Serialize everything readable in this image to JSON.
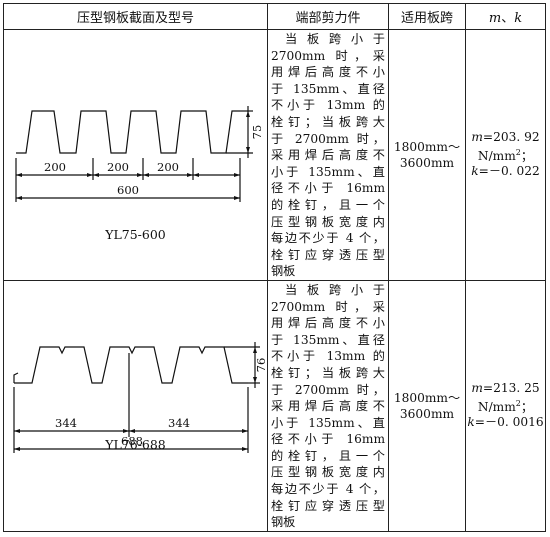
{
  "table": {
    "headers": {
      "section": "压型钢板截面及型号",
      "shear": "端部剪力件",
      "span": "适用板跨",
      "mk_m": "m",
      "mk_sep": "、",
      "mk_k": "k"
    },
    "rows": [
      {
        "model": "YL75-600",
        "dims": {
          "rib1": "200",
          "rib2": "200",
          "rib3": "200",
          "total": "600",
          "height": "75"
        },
        "shear_lines": [
          "当板跨小于",
          "2700mm 时，采",
          "用焊后高度不小",
          "于 135mm、直径",
          "不小于 13mm 的",
          "栓钉；当板跨大",
          "于 2700mm 时，",
          "采用焊后高度不",
          "小于 135mm、直",
          "径不小于 16mm",
          "的栓钉，且一个",
          "压型钢板宽度内",
          "每边不少于 4 个，",
          "栓钉应穿透压型",
          "钢板"
        ],
        "span_line1": "1800mm～",
        "span_line2": "3600mm",
        "m_label": "m",
        "m_value": "=203. 92",
        "unit_base": "N/mm",
        "unit_exp": "2",
        "unit_sep": "；",
        "k_label": "k",
        "k_value": "=－0. 022"
      },
      {
        "model": "YL76-688",
        "dims": {
          "rib1": "344",
          "rib2": "344",
          "total": "688",
          "height": "76"
        },
        "shear_lines": [
          "当板跨小于",
          "2700mm 时，采",
          "用焊后高度不小",
          "于 135mm、直径",
          "不小于 13mm 的",
          "栓钉；当板跨大",
          "于 2700mm 时，",
          "采用焊后高度不",
          "小于 135mm、直",
          "径不小于 16mm",
          "的栓钉，且一个",
          "压型钢板宽度内",
          "每边不少于 4 个，",
          "栓钉应穿透压型",
          "钢板"
        ],
        "span_line1": "1800mm～",
        "span_line2": "3600mm",
        "m_label": "m",
        "m_value": "=213. 25",
        "unit_base": "N/mm",
        "unit_exp": "2",
        "unit_sep": "；",
        "k_label": "k",
        "k_value": "=－0. 0016"
      }
    ]
  }
}
